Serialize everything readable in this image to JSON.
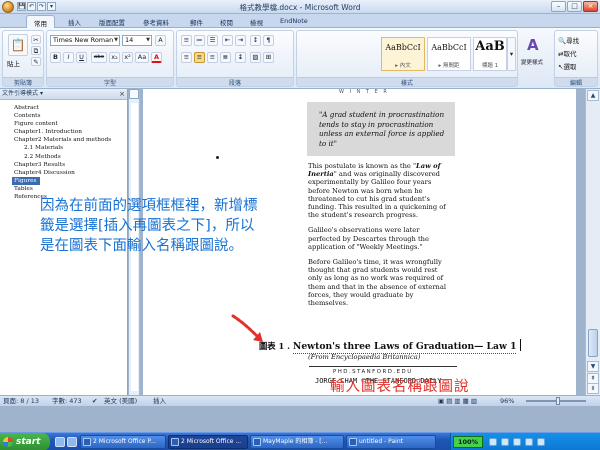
{
  "window": {
    "title": "格式教學檔.docx - Microsoft Word",
    "controls": {
      "minimize": "–",
      "maximize": "□",
      "close": "×"
    }
  },
  "quick_access": {
    "save": "💾",
    "undo": "↶",
    "redo": "↷",
    "more": "▾"
  },
  "tabs": [
    {
      "label": "常用",
      "active": true
    },
    {
      "label": "插入"
    },
    {
      "label": "版面配置"
    },
    {
      "label": "參考資料"
    },
    {
      "label": "郵件"
    },
    {
      "label": "校閱"
    },
    {
      "label": "檢視"
    },
    {
      "label": "EndNote"
    }
  ],
  "ribbon": {
    "clipboard": {
      "label": "剪貼簿",
      "paste": "貼上"
    },
    "font": {
      "label": "字型",
      "family": "Times New Roman",
      "size": "14",
      "buttons": [
        "B",
        "I",
        "U",
        "abe",
        "x₂",
        "x²",
        "Aa",
        "A"
      ]
    },
    "paragraph": {
      "label": "段落"
    },
    "styles": {
      "label": "樣式",
      "items": [
        {
          "sample": "AaBbCcI",
          "name": "▸ 內文"
        },
        {
          "sample": "AaBbCcI",
          "name": "▸ 無間距"
        },
        {
          "sample": "AaB",
          "name": "標題 1"
        }
      ],
      "change_styles": "變更樣式"
    },
    "editing": {
      "label": "編輯",
      "find": "尋找",
      "replace": "取代",
      "select": "選取"
    }
  },
  "nav_pane": {
    "title": "文件引導模式",
    "items": [
      {
        "label": "Abstract"
      },
      {
        "label": "Contents"
      },
      {
        "label": "Figure content"
      },
      {
        "label": "Chapter1. Introduction"
      },
      {
        "label": "Chapter2 Materials and methods"
      },
      {
        "label": "2.1 Materials"
      },
      {
        "label": "2.2 Methods"
      },
      {
        "label": "Chapter3 Results"
      },
      {
        "label": "Chapter4 Discussion"
      },
      {
        "label": "Figures",
        "selected": true
      },
      {
        "label": "Tables"
      },
      {
        "label": "References"
      }
    ]
  },
  "document": {
    "quote_top": "W I N T E R",
    "quote": "\"A grad student in procrastination tends to stay in procrastination unless an external force is applied to it\"",
    "para1_pre": "This postulate is known as the \"",
    "para1_law": "Law of Inertia",
    "para1_post": "\" and was originally discovered experimentally by Galileo four years before Newton was born when he threatened to cut his grad student's funding. This resulted in a quickening of the student's research progress.",
    "para2": "Galileo's observations were later perfected by Descartes through the application of \"Weekly Meetings.\"",
    "para3": "Before Galileo's time, it was wrongfully thought that grad students would rest only as long as no work was required of them and that in the absence of external forces, they would graduate by themselves.",
    "source": "(From Encyclopaedia Britannica)",
    "credit1": "PHD.STANFORD.EDU",
    "credit2": "JORGE CHAM ©THE STANFORD DAILY",
    "caption_prefix": "圖表 1 . ",
    "caption_title": "Newton's three Laws of Graduation— Law 1"
  },
  "annotations": {
    "blue_note": "因為在前面的選項框框裡，新增標籤是選擇[插入再圖表之下]，所以是在圖表下面輸入名稱跟圖說。",
    "red_note": "輸入圖表名稱跟圖說"
  },
  "status": {
    "page": "頁面: 8 / 13",
    "words": "字數: 473",
    "language": "英文 (美國)",
    "mode": "插入",
    "zoom": "96%",
    "zoom_level_pct": 96
  },
  "taskbar": {
    "start": "start",
    "buttons": [
      {
        "label": "2 Microsoft Office P..."
      },
      {
        "label": "2 Microsoft Office ...",
        "active": true
      },
      {
        "label": "MayMaple 的相簿 - [..."
      },
      {
        "label": "untitled - Paint"
      }
    ],
    "battery": "100%"
  },
  "colors": {
    "blue_note": "#1772d4",
    "red_note": "#e2312a",
    "ribbon": "#dde8f5",
    "taskbar": "#1f56b6"
  }
}
